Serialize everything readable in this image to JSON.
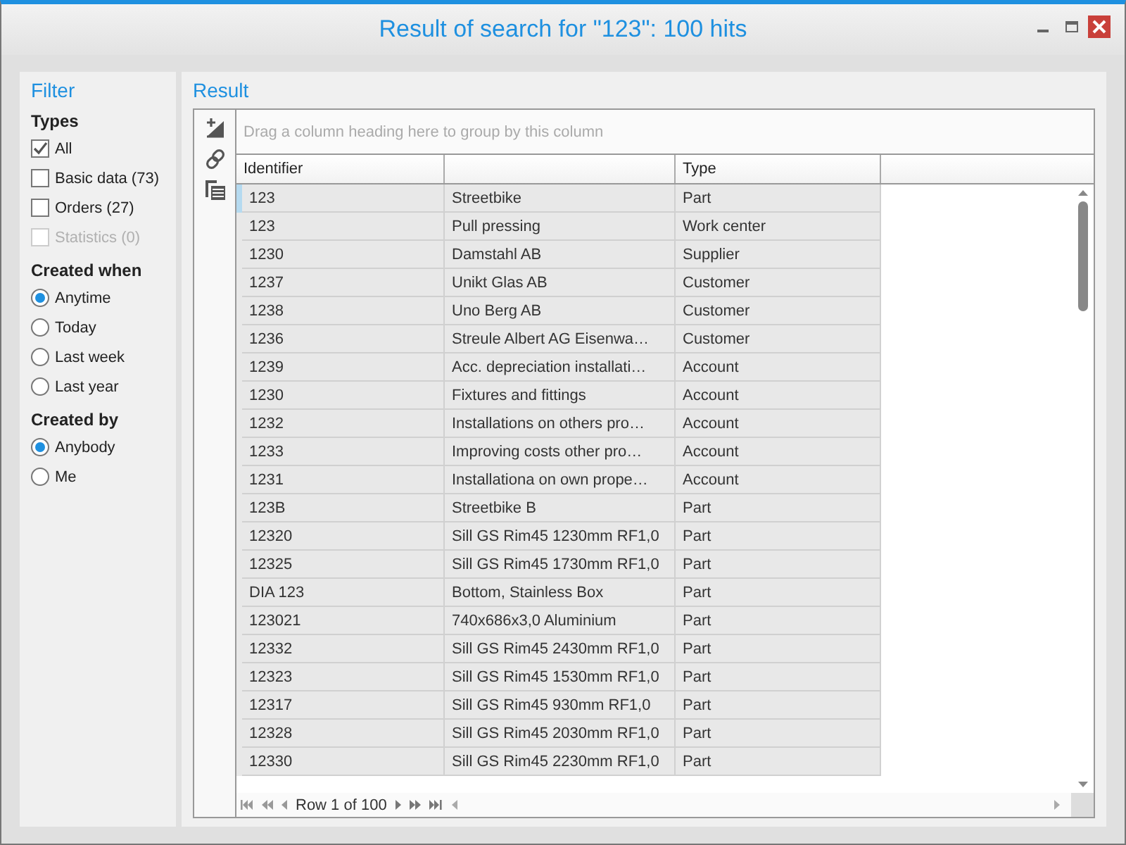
{
  "window": {
    "title": "Result of search for \"123\": 100 hits"
  },
  "filter": {
    "title": "Filter",
    "groups": [
      {
        "title": "Types",
        "items": [
          {
            "kind": "checkbox",
            "label": "All",
            "checked": true,
            "disabled": false
          },
          {
            "kind": "checkbox",
            "label": "Basic data (73)",
            "checked": false,
            "disabled": false
          },
          {
            "kind": "checkbox",
            "label": "Orders (27)",
            "checked": false,
            "disabled": false
          },
          {
            "kind": "checkbox",
            "label": "Statistics (0)",
            "checked": false,
            "disabled": true
          }
        ]
      },
      {
        "title": "Created when",
        "items": [
          {
            "kind": "radio",
            "label": "Anytime",
            "selected": true
          },
          {
            "kind": "radio",
            "label": "Today",
            "selected": false
          },
          {
            "kind": "radio",
            "label": "Last week",
            "selected": false
          },
          {
            "kind": "radio",
            "label": "Last year",
            "selected": false
          }
        ]
      },
      {
        "title": "Created by",
        "items": [
          {
            "kind": "radio",
            "label": "Anybody",
            "selected": true
          },
          {
            "kind": "radio",
            "label": "Me",
            "selected": false
          }
        ]
      }
    ]
  },
  "result": {
    "title": "Result",
    "group_panel": {
      "placeholder": "Drag a column heading here to group by this column"
    },
    "table": {
      "columns": [
        "Identifier",
        "",
        "Type"
      ],
      "rows": [
        {
          "cells": [
            "123",
            "Streetbike",
            "Part"
          ],
          "selected": true
        },
        {
          "cells": [
            "123",
            "Pull pressing",
            "Work center"
          ],
          "selected": false
        },
        {
          "cells": [
            "1230",
            "Damstahl AB",
            "Supplier"
          ],
          "selected": false
        },
        {
          "cells": [
            "1237",
            "Unikt Glas AB",
            "Customer"
          ],
          "selected": false
        },
        {
          "cells": [
            "1238",
            "Uno Berg AB",
            "Customer"
          ],
          "selected": false
        },
        {
          "cells": [
            "1236",
            "Streule Albert AG Eisenwa…",
            "Customer"
          ],
          "selected": false
        },
        {
          "cells": [
            "1239",
            "Acc. depreciation installati…",
            "Account"
          ],
          "selected": false
        },
        {
          "cells": [
            "1230",
            "Fixtures and fittings",
            "Account"
          ],
          "selected": false
        },
        {
          "cells": [
            "1232",
            "Installations on others pro…",
            "Account"
          ],
          "selected": false
        },
        {
          "cells": [
            "1233",
            "Improving costs other pro…",
            "Account"
          ],
          "selected": false
        },
        {
          "cells": [
            "1231",
            "Installationa on own prope…",
            "Account"
          ],
          "selected": false
        },
        {
          "cells": [
            "123B",
            "Streetbike B",
            "Part"
          ],
          "selected": false
        },
        {
          "cells": [
            "12320",
            "Sill GS Rim45 1230mm RF1,0",
            "Part"
          ],
          "selected": false
        },
        {
          "cells": [
            "12325",
            "Sill GS Rim45 1730mm RF1,0",
            "Part"
          ],
          "selected": false
        },
        {
          "cells": [
            "DIA 123",
            "Bottom, Stainless Box",
            "Part"
          ],
          "selected": false
        },
        {
          "cells": [
            "123021",
            "740x686x3,0 Aluminium",
            "Part"
          ],
          "selected": false
        },
        {
          "cells": [
            "12332",
            "Sill GS Rim45 2430mm RF1,0",
            "Part"
          ],
          "selected": false
        },
        {
          "cells": [
            "12323",
            "Sill GS Rim45 1530mm RF1,0",
            "Part"
          ],
          "selected": false
        },
        {
          "cells": [
            "12317",
            "Sill GS Rim45 930mm RF1,0",
            "Part"
          ],
          "selected": false
        },
        {
          "cells": [
            "12328",
            "Sill GS Rim45 2030mm RF1,0",
            "Part"
          ],
          "selected": false
        },
        {
          "cells": [
            "12330",
            "Sill GS Rim45 2230mm RF1,0",
            "Part"
          ],
          "selected": false
        }
      ]
    },
    "navigator": {
      "text": "Row 1 of 100"
    }
  }
}
